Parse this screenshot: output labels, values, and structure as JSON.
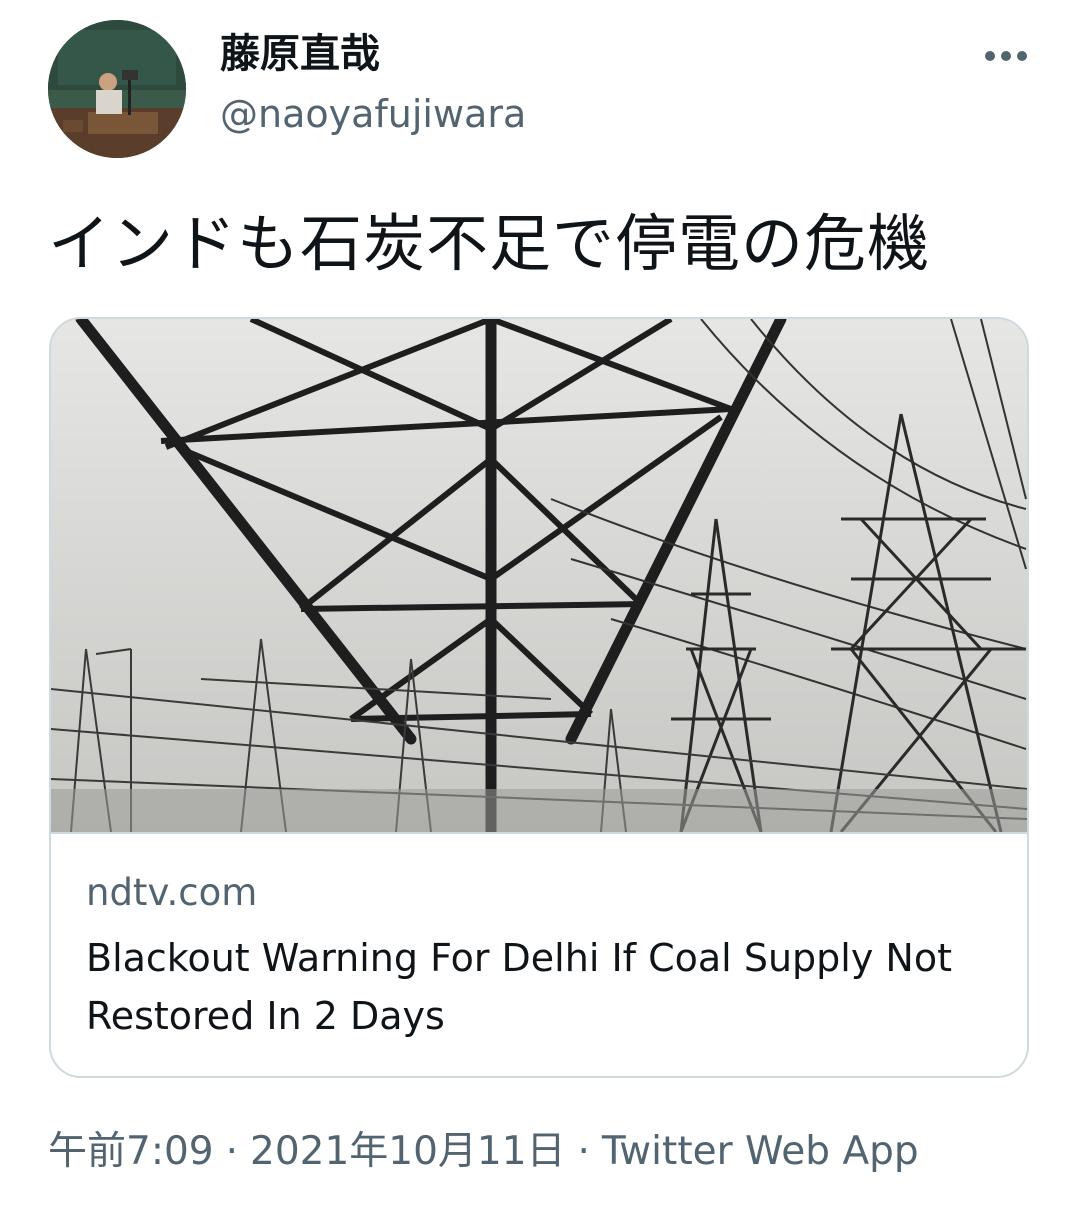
{
  "author": {
    "display_name": "藤原直哉",
    "handle": "@naoyafujiwara"
  },
  "tweet": {
    "text": "インドも石炭不足で停電の危機"
  },
  "card": {
    "domain": "ndtv.com",
    "title": "Blackout Warning For Delhi If Coal Supply Not Restored In 2 Days"
  },
  "meta": {
    "time": "午前7:09",
    "separator": "·",
    "date": "2021年10月11日",
    "source": "Twitter Web App"
  },
  "icons": {
    "more": "more-horizontal-icon",
    "avatar": "profile-photo"
  },
  "colors": {
    "text_primary": "#0f1419",
    "text_secondary": "#536471",
    "border": "#cfd9de"
  }
}
